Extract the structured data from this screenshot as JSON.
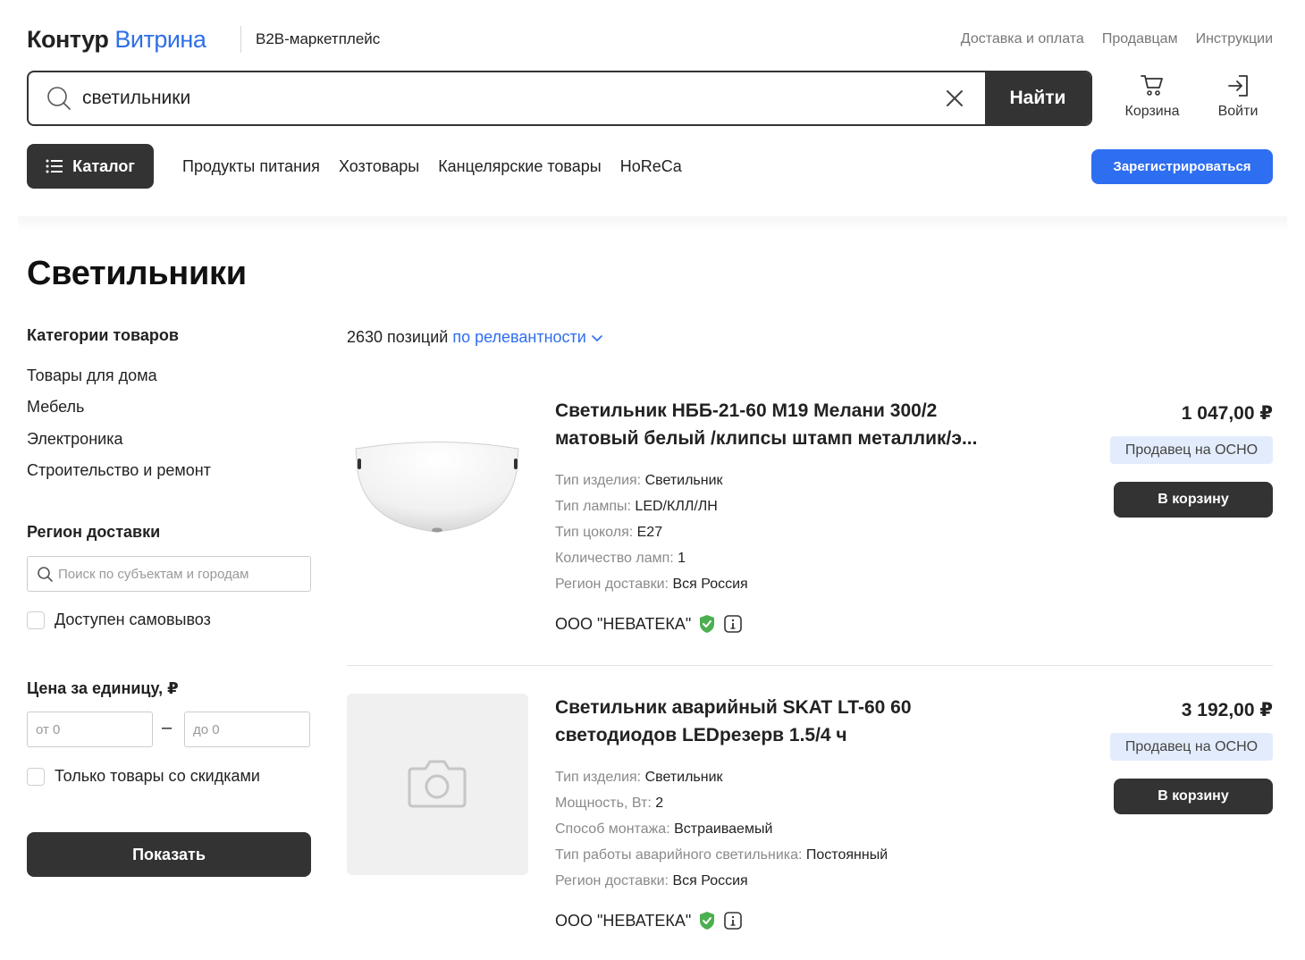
{
  "header": {
    "logo_brand": "Контур",
    "logo_product": "Витрина",
    "tagline": "B2B-маркетплейс",
    "links": [
      "Доставка и оплата",
      "Продавцам",
      "Инструкции"
    ]
  },
  "search": {
    "value": "светильники",
    "button_label": "Найти"
  },
  "actions": {
    "cart_label": "Корзина",
    "login_label": "Войти"
  },
  "nav": {
    "catalog_label": "Каталог",
    "links": [
      "Продукты питания",
      "Хозтовары",
      "Канцелярские товары",
      "HoReCa"
    ],
    "register_label": "Зарегистрироваться"
  },
  "page_title": "Светильники",
  "sidebar": {
    "categories_heading": "Категории товаров",
    "categories": [
      "Товары для дома",
      "Мебель",
      "Электроника",
      "Строительство и ремонт"
    ],
    "region_heading": "Регион доставки",
    "region_placeholder": "Поиск по субъектам и городам",
    "pickup_label": "Доступен самовывоз",
    "price_heading": "Цена за единицу, ₽",
    "price_from_placeholder": "от 0",
    "price_to_placeholder": "до 0",
    "price_dash": "–",
    "discount_label": "Только товары со скидками",
    "show_button": "Показать"
  },
  "results": {
    "count_text": "2630 позиций",
    "sort_label": "по релевантности"
  },
  "products": [
    {
      "title_line1": "Светильник НББ-21-60 М19 Мелани 300/2",
      "title_line2": "матовый белый /клипсы штамп металлик/э...",
      "props": [
        {
          "k": "Тип изделия:",
          "v": "Светильник"
        },
        {
          "k": "Тип лампы:",
          "v": "LED/КЛЛ/ЛН"
        },
        {
          "k": "Тип цоколя:",
          "v": "E27"
        },
        {
          "k": "Количество ламп:",
          "v": "1"
        },
        {
          "k": "Регион доставки:",
          "v": "Вся Россия"
        }
      ],
      "seller": "ООО \"НЕВАТЕКА\"",
      "price": "1 047,00 ₽",
      "badge": "Продавец на ОСНО",
      "cart_button": "В корзину",
      "image": "lamp-photo"
    },
    {
      "title_line1": "Светильник аварийный SKAT LT-60 60",
      "title_line2": "светодиодов LEDрезерв 1.5/4 ч",
      "props": [
        {
          "k": "Тип изделия:",
          "v": "Светильник"
        },
        {
          "k": "Мощность, Вт:",
          "v": "2"
        },
        {
          "k": "Способ монтажа:",
          "v": "Встраиваемый"
        },
        {
          "k": "Тип работы аварийного светильника:",
          "v": "Постоянный"
        },
        {
          "k": "Регион доставки:",
          "v": "Вся Россия"
        }
      ],
      "seller": "ООО \"НЕВАТЕКА\"",
      "price": "3 192,00 ₽",
      "badge": "Продавец на ОСНО",
      "cart_button": "В корзину",
      "image": "camera-placeholder-icon"
    }
  ],
  "colors": {
    "accent_blue": "#2e6ef0",
    "dark_button": "#333333",
    "badge_bg": "#e3ecfc",
    "verified_green": "#4caf50"
  }
}
